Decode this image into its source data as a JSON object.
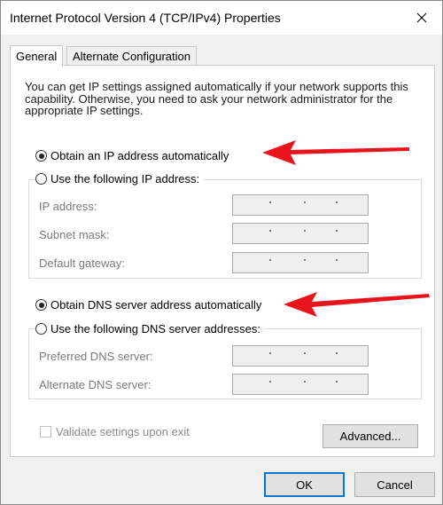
{
  "window": {
    "title": "Internet Protocol Version 4 (TCP/IPv4) Properties"
  },
  "tabs": [
    {
      "label": "General",
      "selected": true
    },
    {
      "label": "Alternate Configuration",
      "selected": false
    }
  ],
  "description": "You can get IP settings assigned automatically if your network supports this capability. Otherwise, you need to ask your network administrator for the appropriate IP settings.",
  "ip_section": {
    "auto_label": "Obtain an IP address automatically",
    "auto_selected": true,
    "manual_label": "Use the following IP address:",
    "fields": [
      {
        "label": "IP address:",
        "value": ". . ."
      },
      {
        "label": "Subnet mask:",
        "value": ". . ."
      },
      {
        "label": "Default gateway:",
        "value": ". . ."
      }
    ]
  },
  "dns_section": {
    "auto_label": "Obtain DNS server address automatically",
    "auto_selected": true,
    "manual_label": "Use the following DNS server addresses:",
    "fields": [
      {
        "label": "Preferred DNS server:",
        "value": ". . ."
      },
      {
        "label": "Alternate DNS server:",
        "value": ". . ."
      }
    ]
  },
  "validate": {
    "label": "Validate settings upon exit",
    "checked": false
  },
  "buttons": {
    "advanced": "Advanced...",
    "ok": "OK",
    "cancel": "Cancel"
  },
  "colors": {
    "arrow": "#e8141c",
    "focus": "#0078d7"
  }
}
